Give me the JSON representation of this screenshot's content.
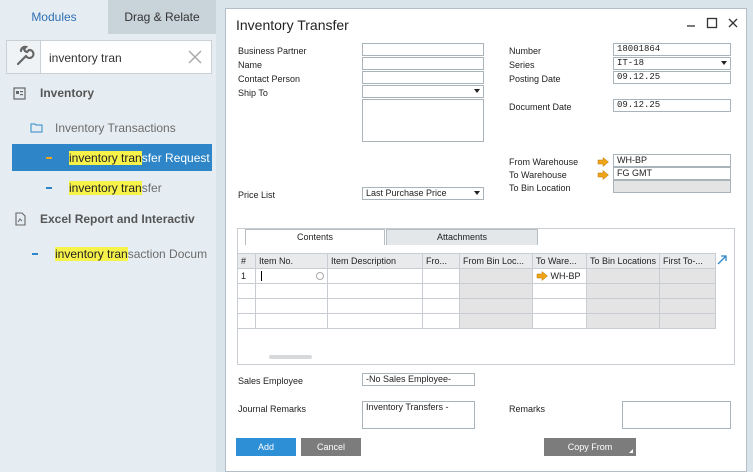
{
  "left_panel": {
    "tabs": {
      "modules": "Modules",
      "drag_relate": "Drag & Relate"
    },
    "search": {
      "value": "inventory tran"
    },
    "tree": {
      "inventory": "Inventory",
      "inventory_transactions": "Inventory Transactions",
      "item1": {
        "highlight": "inventory tran",
        "rest": "sfer Request"
      },
      "item2": {
        "highlight": "inventory tran",
        "rest": "sfer"
      },
      "excel": "Excel Report and Interactiv",
      "item3": {
        "highlight": "inventory tran",
        "rest": "saction Docum"
      }
    }
  },
  "window": {
    "title": "Inventory Transfer",
    "header": {
      "business_partner_label": "Business Partner",
      "name_label": "Name",
      "contact_person_label": "Contact Person",
      "ship_to_label": "Ship To",
      "number_label": "Number",
      "number_value": "18001864",
      "series_label": "Series",
      "series_value": "IT-18",
      "posting_date_label": "Posting Date",
      "posting_date_value": "09.12.25",
      "document_date_label": "Document Date",
      "document_date_value": "09.12.25",
      "from_warehouse_label": "From Warehouse",
      "from_warehouse_value": "WH-BP",
      "to_warehouse_label": "To Warehouse",
      "to_warehouse_value": "FG GMT",
      "to_bin_location_label": "To Bin Location",
      "price_list_label": "Price List",
      "price_list_value": "Last Purchase Price"
    },
    "tabs": {
      "contents": "Contents",
      "attachments": "Attachments"
    },
    "grid": {
      "columns": [
        "#",
        "Item No.",
        "Item Description",
        "Fro...",
        "From Bin Loc...",
        "To Ware...",
        "To Bin Locations",
        "First To-..."
      ],
      "rows": [
        {
          "num": "1",
          "to_warehouse": "WH-BP"
        }
      ]
    },
    "footer": {
      "sales_employee_label": "Sales Employee",
      "sales_employee_value": "-No Sales Employee-",
      "journal_remarks_label": "Journal Remarks",
      "journal_remarks_value": "Inventory Transfers -",
      "remarks_label": "Remarks",
      "add_label": "Add",
      "cancel_label": "Cancel",
      "copy_from_label": "Copy From"
    }
  },
  "colors": {
    "selection": "#2e86c8",
    "highlight": "#f7f24a",
    "link_arrow": "#f0a418",
    "add_button": "#2d8fd5",
    "gray_button": "#7c7c7c"
  }
}
